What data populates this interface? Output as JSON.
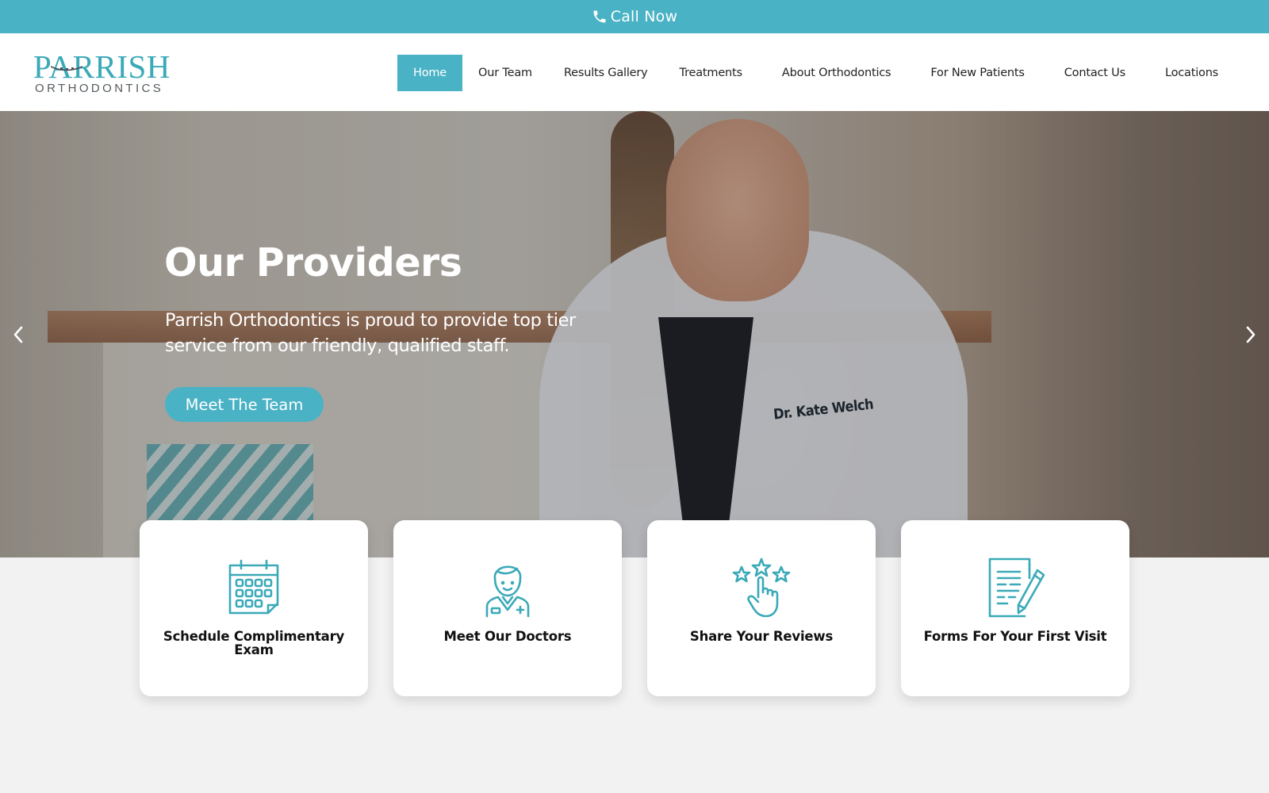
{
  "topbar": {
    "call_label": "Call Now",
    "icon": "phone-icon"
  },
  "brand": {
    "name": "PARRISH",
    "subtitle": "ORTHODONTICS",
    "accent_color": "#4ab2c5"
  },
  "nav": {
    "items": [
      {
        "label": "Home",
        "active": true
      },
      {
        "label": "Our Team",
        "active": false
      },
      {
        "label": "Results Gallery",
        "active": false
      },
      {
        "label": "Treatments",
        "active": false
      },
      {
        "label": "About Orthodontics",
        "active": false
      },
      {
        "label": "For New Patients",
        "active": false
      },
      {
        "label": "Contact Us",
        "active": false
      },
      {
        "label": "Locations",
        "active": false
      }
    ]
  },
  "hero": {
    "title": "Our Providers",
    "description": "Parrish Orthodontics is proud to provide top tier service from our friendly, qualified staff.",
    "cta_label": "Meet The Team",
    "badge_text": "Dr. Kate Welch",
    "prev_icon": "chevron-left-icon",
    "next_icon": "chevron-right-icon"
  },
  "cards": [
    {
      "label": "Schedule Complimentary Exam",
      "icon": "calendar-icon"
    },
    {
      "label": "Meet Our Doctors",
      "icon": "doctor-icon"
    },
    {
      "label": "Share Your Reviews",
      "icon": "star-rating-icon"
    },
    {
      "label": "Forms For Your First Visit",
      "icon": "form-pencil-icon"
    }
  ]
}
